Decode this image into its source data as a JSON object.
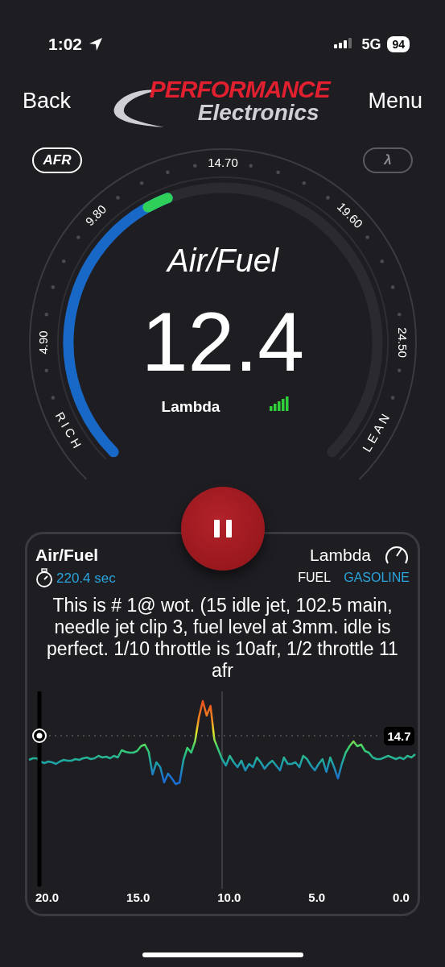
{
  "status_bar": {
    "time": "1:02",
    "network": "5G",
    "battery": "94"
  },
  "nav": {
    "back": "Back",
    "menu": "Menu",
    "logo": {
      "line_1": "PERFORMANCE",
      "line_2": "Electronics"
    }
  },
  "units": [
    {
      "label": "AFR",
      "selected": true
    },
    {
      "label": "λ",
      "selected": false
    }
  ],
  "gauge": {
    "title": "Air/Fuel",
    "value": "12.4",
    "subtitle": "Lambda",
    "scale": [
      "4.90",
      "9.80",
      "14.70",
      "19.60",
      "24.50"
    ],
    "left_label": "RICH",
    "right_label": "LEAN"
  },
  "log": {
    "title": "Air/Fuel",
    "duration": "220.4 sec",
    "sensor": "Lambda",
    "fuel_label": "FUEL",
    "fuel": "GASOLINE",
    "note": "This is # 1@ wot. (15 idle jet, 102.5 main, needle jet clip 3, fuel level at 3mm. idle is perfect. 1/10 throttle is 10afr, 1/2 throttle 11 afr",
    "reference": "14.7",
    "x_ticks": [
      "20.0",
      "15.0",
      "10.0",
      "5.0",
      "0.0"
    ]
  }
}
